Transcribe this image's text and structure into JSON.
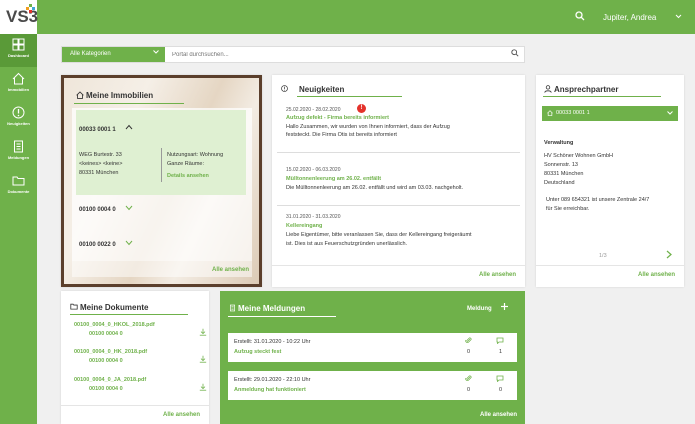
{
  "app": {
    "logo_text": "VS3",
    "user_name": "Jupiter, Andrea",
    "logo_colors": [
      "#6fb14a",
      "#f29e1f",
      "#3fa8d8",
      "#e4322b"
    ]
  },
  "colors": {
    "accent": "#6fb14a",
    "alert": "#e4322b"
  },
  "sidebar": {
    "items": [
      {
        "label": "Dashboard",
        "icon": "dashboard-icon"
      },
      {
        "label": "Immobilien",
        "icon": "home-icon"
      },
      {
        "label": "Neuigkeiten",
        "icon": "alert-circle-icon"
      },
      {
        "label": "Meldungen",
        "icon": "document-list-icon"
      },
      {
        "label": "Dokumente",
        "icon": "folder-icon"
      }
    ]
  },
  "filter": {
    "category_label": "Alle Kategorien",
    "search_placeholder": "Portal durchsuchen..."
  },
  "immobilien": {
    "title": "Meine Immobilien",
    "properties": [
      {
        "id": "00033 0001 1"
      },
      {
        "id": "00100 0004 0"
      },
      {
        "id": "00100 0022 0"
      }
    ],
    "detail": {
      "line1": "WEG Burtestr. 33",
      "line2": "<keines> <keine>",
      "line3": "80331 München",
      "usage": "Nutzungsart: Wohnung",
      "rooms": "Ganze Räume:",
      "details_link": "Details ansehen"
    },
    "view_all": "Alle ansehen"
  },
  "news": {
    "title": "Neuigkeiten",
    "items": [
      {
        "date": "25.02.2020 - 28.02.2020",
        "headline": "Aufzug defekt - Firma bereits informiert",
        "text1": "Hallo Zusammen, wir wurden von Ihnen informiert, dass der Aufzug",
        "text2": "feststeckt. Die Firma Otis ist bereits informiert"
      },
      {
        "date": "15.02.2020 - 06.03.2020",
        "headline": "Mülltonnenleerung am 26.02. entfällt",
        "text1": "Die Mülltonnenleerung am 26.02. entfällt und wird am 03.03. nachgeholt.",
        "text2": ""
      },
      {
        "date": "31.01.2020 - 31.03.2020",
        "headline": "Kellereingang",
        "text1": "Liebe Eigentümer, bitte veranlassen Sie, dass der Kellereingang freigeräumt",
        "text2": "ist. Dies ist aus Feuerschutzgründen unerlässlich."
      }
    ],
    "alert_badge": "!",
    "view_all": "Alle ansehen"
  },
  "contact": {
    "title": "Ansprechpartner",
    "selected": "00033 0001 1",
    "section": "Verwaltung",
    "company": "HV Schöner Wohnen GmbH",
    "street": "Sonnenstr. 13",
    "city": "80331 München",
    "country": "Deutschland",
    "phone_line1": "Unter 089 654321 ist unsere Zentrale 24/7",
    "phone_line2": "für Sie erreichbar.",
    "pager": "1/3",
    "view_all": "Alle ansehen"
  },
  "documents": {
    "title": "Meine Dokumente",
    "items": [
      {
        "name": "00100_0004_0_HKOL_2018.pdf",
        "sub": "00100 0004 0"
      },
      {
        "name": "00100_0004_0_HK_2018.pdf",
        "sub": "00100 0004 0"
      },
      {
        "name": "00100_0004_0_JA_2018.pdf",
        "sub": "00100 0004 0"
      }
    ],
    "view_all": "Alle ansehen"
  },
  "meldungen": {
    "title": "Meine Meldungen",
    "add_label": "Meldung",
    "items": [
      {
        "created": "Erstellt: 31.01.2020 - 10:22 Uhr",
        "title": "Aufzug steckt fest",
        "attachments": "0",
        "comments": "1"
      },
      {
        "created": "Erstellt: 29.01.2020 - 22:10 Uhr",
        "title": "Anmeldung hat funktioniert",
        "attachments": "0",
        "comments": "0"
      }
    ],
    "view_all": "Alle ansehen"
  }
}
